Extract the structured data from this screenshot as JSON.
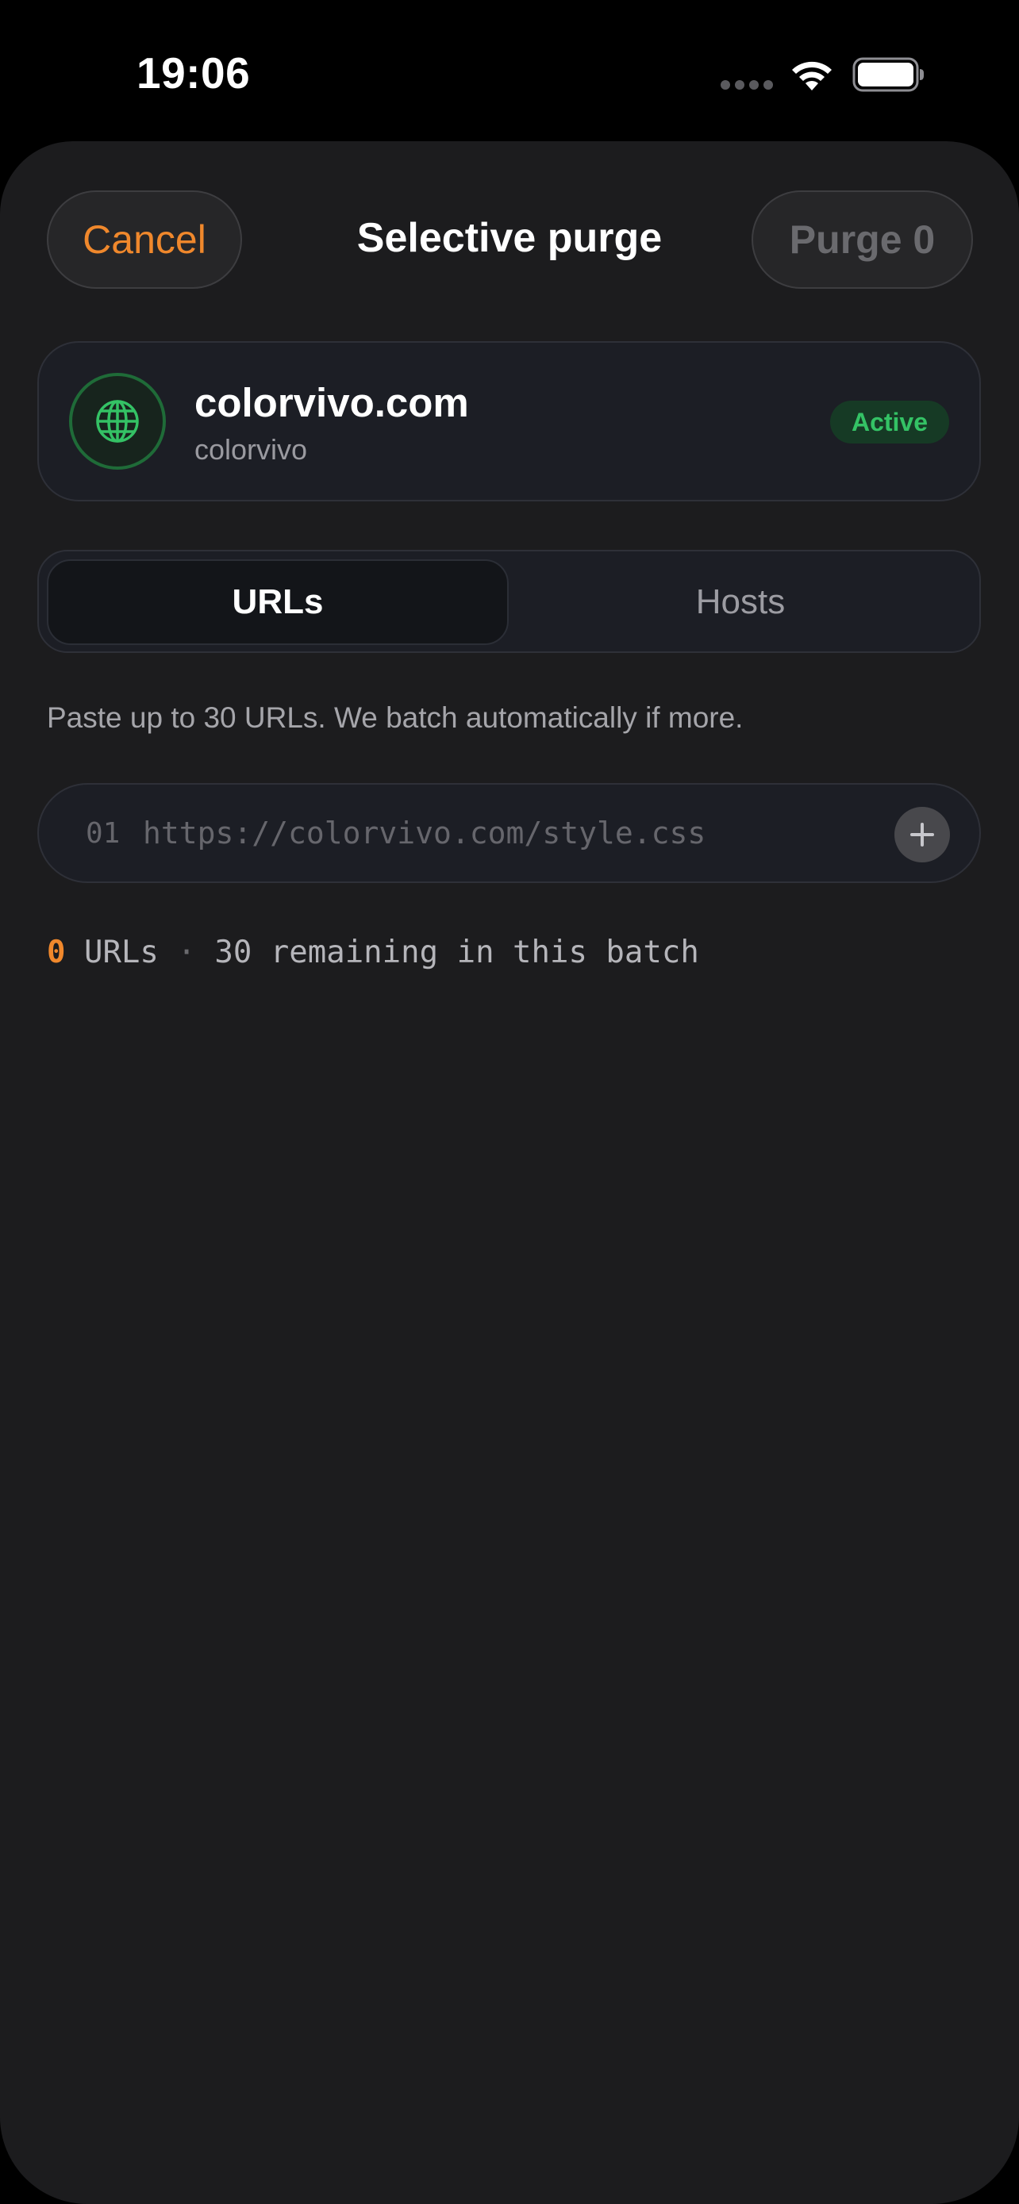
{
  "status_bar": {
    "time": "19:06"
  },
  "header": {
    "cancel_label": "Cancel",
    "title": "Selective purge",
    "purge_label": "Purge 0"
  },
  "zone": {
    "name": "colorvivo.com",
    "account": "colorvivo",
    "status": "Active",
    "icon": "globe-icon"
  },
  "tabs": [
    {
      "label": "URLs",
      "selected": true
    },
    {
      "label": "Hosts",
      "selected": false
    }
  ],
  "helper_text": "Paste up to 30 URLs. We batch automatically if more.",
  "url_input": {
    "line_number": "01",
    "value": "",
    "placeholder": "https://colorvivo.com/style.css"
  },
  "counter": {
    "count": "0",
    "unit": "URLs",
    "separator": "·",
    "remaining": "30 remaining in this batch"
  },
  "colors": {
    "accent": "#f0882c",
    "success": "#34c265",
    "background": "#1c1c1e",
    "card": "#1c1e25"
  }
}
